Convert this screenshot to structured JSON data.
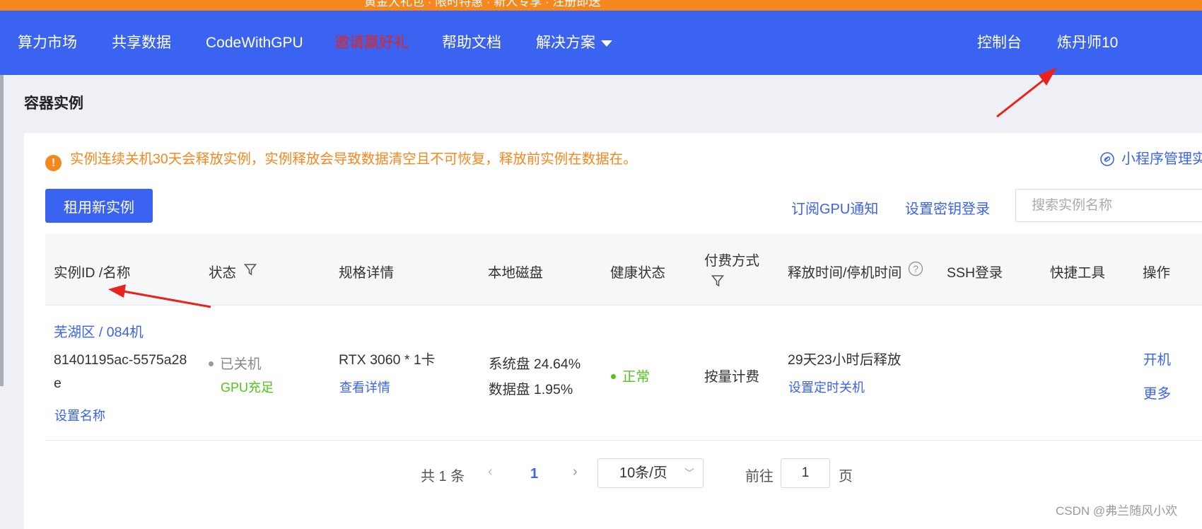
{
  "top_strip": {
    "text": "黄金大礼包 · 限时特惠 · 新人专享 · 注册即送"
  },
  "nav": {
    "items": [
      "算力市场",
      "共享数据",
      "CodeWithGPU",
      "邀请赢好礼",
      "帮助文档",
      "解决方案"
    ],
    "console": "控制台",
    "user": "炼丹师10",
    "brand_color": "#3a63f2",
    "highlight_color": "#e8231b"
  },
  "page_title": "容器实例",
  "notice": {
    "text": "实例连续关机30天会释放实例，实例释放会导致数据清空且不可恢复，释放前实例在数据在。",
    "icon": "warning-circle-icon",
    "color": "#f5871f"
  },
  "mini_program": {
    "label": "小程序管理实",
    "icon": "link-icon"
  },
  "toolbar": {
    "new_instance": "租用新实例",
    "subscribe": "订阅GPU通知",
    "ssh_key": "设置密钥登录",
    "search_placeholder": "搜索实例名称"
  },
  "table": {
    "headers": {
      "id": "实例ID /名称",
      "status": "状态",
      "spec": "规格详情",
      "disk": "本地磁盘",
      "health": "健康状态",
      "billing": "付费方式",
      "release": "释放时间/停机时间",
      "ssh": "SSH登录",
      "tools": "快捷工具",
      "ops": "操作"
    },
    "rows": [
      {
        "region": "芜湖区 / 084机",
        "id_line1": "81401195ac-5575a28",
        "id_line2": "e",
        "set_name": "设置名称",
        "status": "已关机",
        "gpu_status": "GPU充足",
        "spec": "RTX 3060 * 1卡",
        "spec_link": "查看详情",
        "disk_system": "系统盘 24.64%",
        "disk_data": "数据盘 1.95%",
        "health": "正常",
        "billing": "按量计费",
        "release": "29天23小时后释放",
        "release_link": "设置定时关机",
        "op_start": "开机",
        "op_more": "更多"
      }
    ]
  },
  "pagination": {
    "total": "共 1 条",
    "current_page": "1",
    "page_size": "10条/页",
    "goto_label": "前往",
    "goto_value": "1",
    "page_unit": "页"
  },
  "watermark": "CSDN @弗兰随风小欢",
  "annotation_color": "#e8231b"
}
